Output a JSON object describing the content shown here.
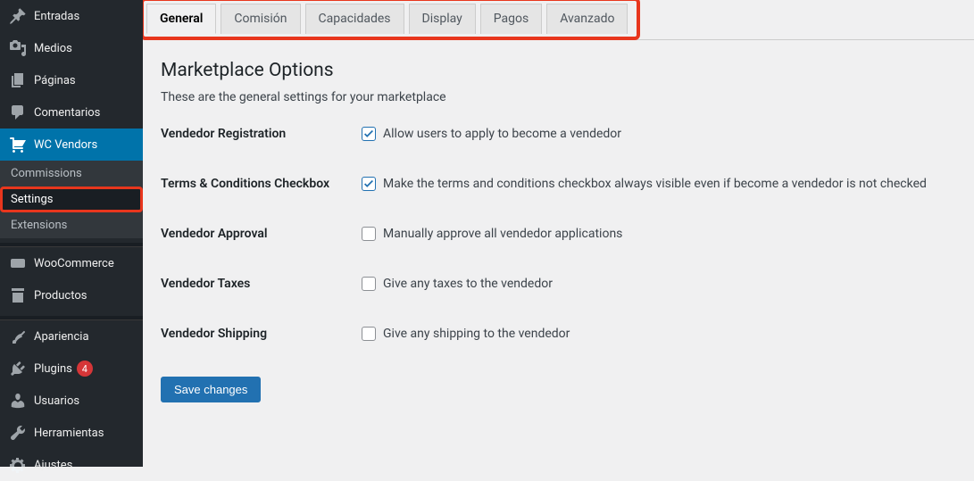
{
  "sidebar": {
    "items": [
      {
        "label": "Entradas"
      },
      {
        "label": "Medios"
      },
      {
        "label": "Páginas"
      },
      {
        "label": "Comentarios"
      },
      {
        "label": "WC Vendors"
      },
      {
        "label": "WooCommerce"
      },
      {
        "label": "Productos"
      },
      {
        "label": "Apariencia"
      },
      {
        "label": "Plugins"
      },
      {
        "label": "Usuarios"
      },
      {
        "label": "Herramientas"
      },
      {
        "label": "Ajustes"
      }
    ],
    "sub": {
      "commissions": "Commissions",
      "settings": "Settings",
      "extensions": "Extensions"
    },
    "plugin_badge": "4"
  },
  "tabs": [
    "General",
    "Comisión",
    "Capacidades",
    "Display",
    "Pagos",
    "Avanzado"
  ],
  "page": {
    "title": "Marketplace Options",
    "desc": "These are the general settings for your marketplace"
  },
  "form": {
    "rows": [
      {
        "label": "Vendedor Registration",
        "text": "Allow users to apply to become a vendedor",
        "checked": true
      },
      {
        "label": "Terms & Conditions Checkbox",
        "text": "Make the terms and conditions checkbox always visible even if become a vendedor is not checked",
        "checked": true
      },
      {
        "label": "Vendedor Approval",
        "text": "Manually approve all vendedor applications",
        "checked": false
      },
      {
        "label": "Vendedor Taxes",
        "text": "Give any taxes to the vendedor",
        "checked": false
      },
      {
        "label": "Vendedor Shipping",
        "text": "Give any shipping to the vendedor",
        "checked": false
      }
    ],
    "save": "Save changes"
  }
}
